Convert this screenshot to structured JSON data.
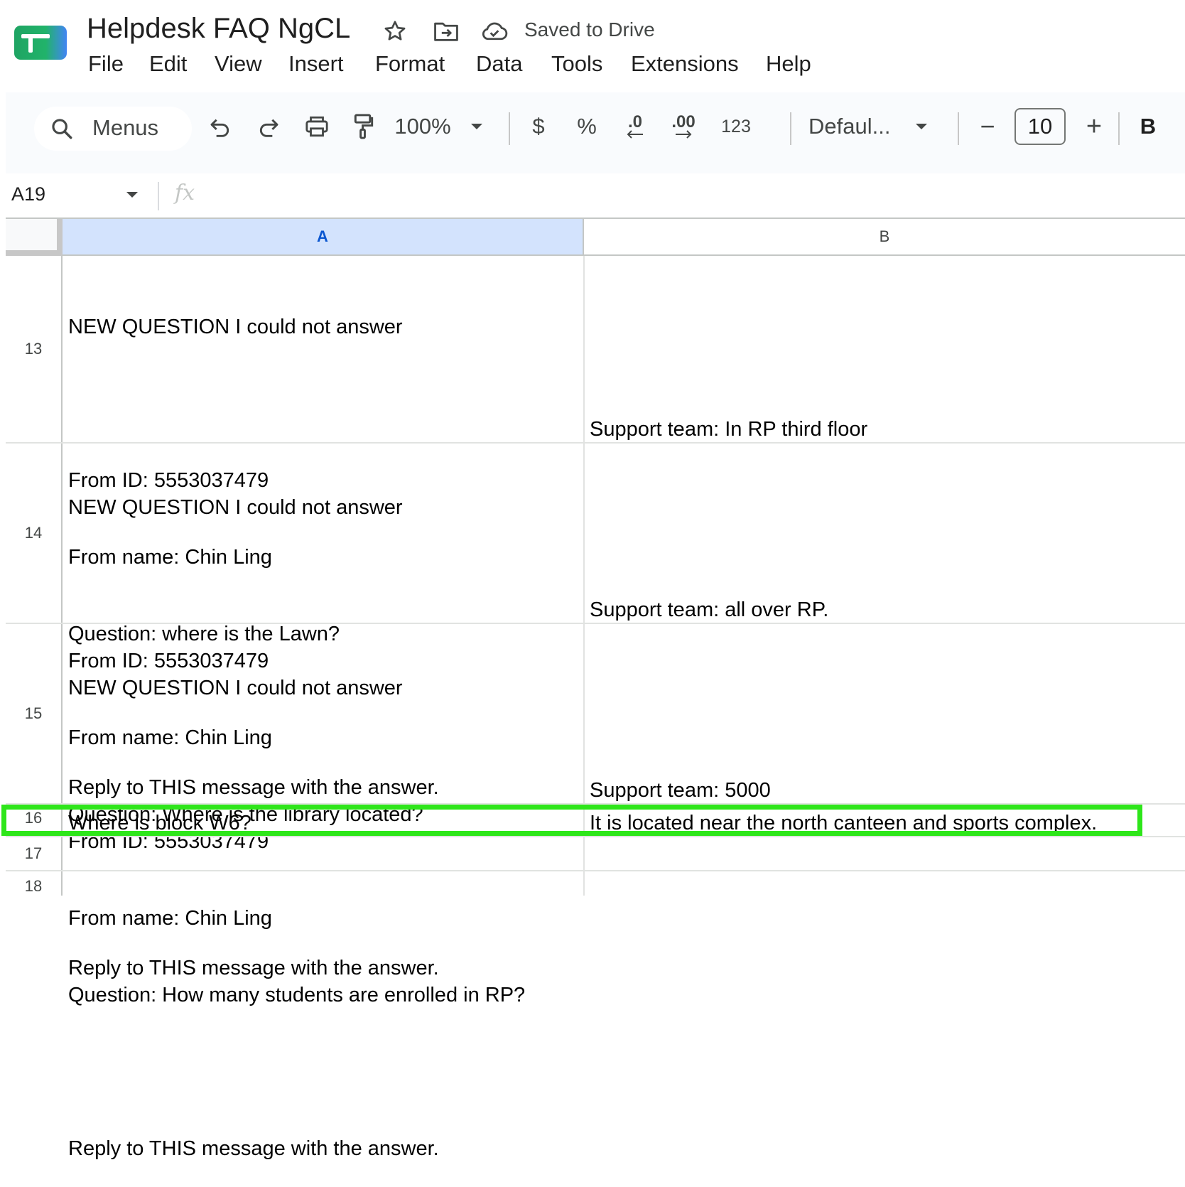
{
  "header": {
    "doc_title": "Helpdesk FAQ NgCL",
    "save_status": "Saved to Drive",
    "menu": [
      "File",
      "Edit",
      "View",
      "Insert",
      "Format",
      "Data",
      "Tools",
      "Extensions",
      "Help"
    ]
  },
  "toolbar": {
    "search_label": "Menus",
    "zoom": "100%",
    "currency": "$",
    "percent": "%",
    "dec_decrease": ".0",
    "dec_increase": ".00",
    "number_format": "123",
    "font": "Defaul...",
    "font_size": "10",
    "minus": "−",
    "plus": "+",
    "bold": "B"
  },
  "formula_bar": {
    "cell_ref": "A19",
    "fx": "fx",
    "value": ""
  },
  "columns": [
    "A",
    "B"
  ],
  "rows": [
    {
      "num": "13",
      "a": [
        "NEW QUESTION I could not answer",
        "",
        "From ID: 5553037479",
        "From name: Chin Ling",
        "Question: where is the Lawn?",
        "",
        "Reply to THIS message with the answer."
      ],
      "b": "Support team: In RP third floor"
    },
    {
      "num": "14",
      "a": [
        "NEW QUESTION I could not answer",
        "",
        "From ID: 5553037479",
        "From name: Chin Ling",
        "Question: Where is the library located?",
        "",
        "Reply to THIS message with the answer."
      ],
      "b": "Support team: all over RP."
    },
    {
      "num": "15",
      "a": [
        "NEW QUESTION I could not answer",
        "",
        "From ID: 5553037479",
        "From name: Chin Ling",
        "Question: How many students are enrolled in RP?",
        "",
        "Reply to THIS message with the answer."
      ],
      "b": "Support team: 5000"
    },
    {
      "num": "16",
      "a": [
        "Where is block W6?"
      ],
      "b": "It is located near the north canteen and sports complex."
    },
    {
      "num": "17",
      "a": [
        ""
      ],
      "b": ""
    },
    {
      "num": "18",
      "a": [
        ""
      ],
      "b": ""
    }
  ],
  "colors": {
    "highlight": "#2ee61a",
    "selected_col": "#d3e3fd",
    "accent": "#0b57d0"
  }
}
